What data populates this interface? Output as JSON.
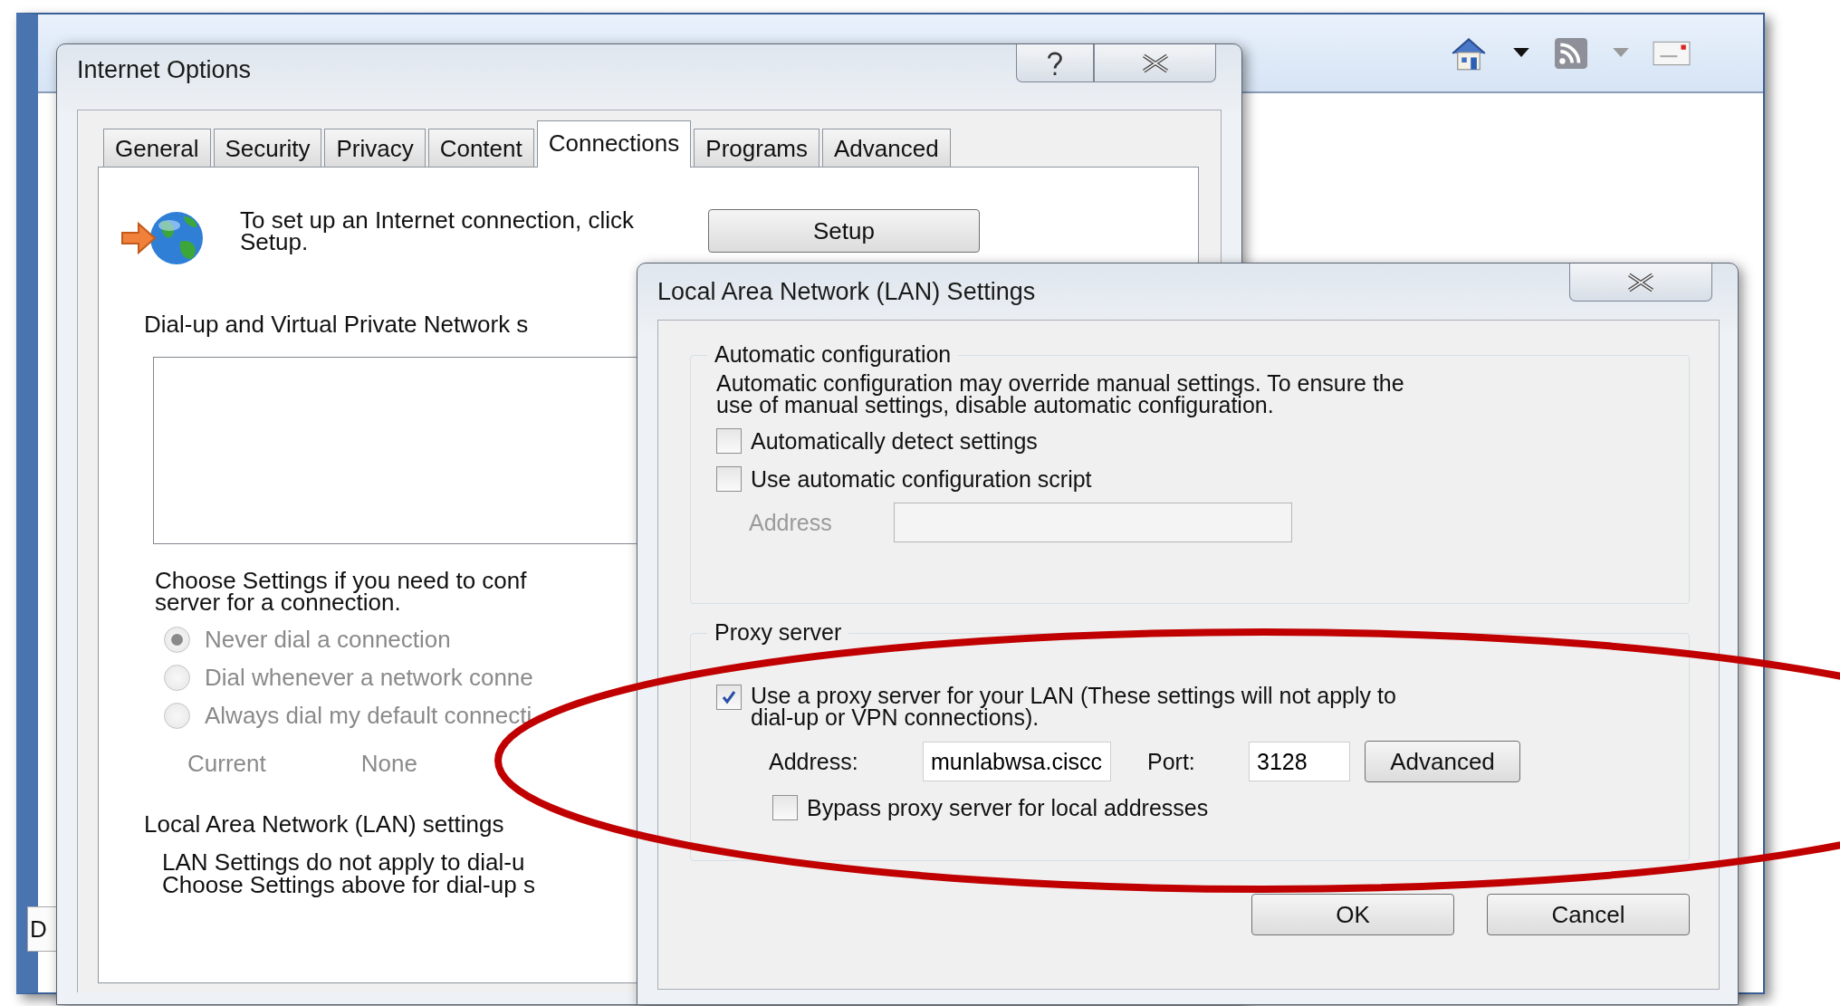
{
  "browser": {
    "tab_label": "D"
  },
  "internet_options": {
    "title": "Internet Options",
    "tabs": [
      {
        "label": "General",
        "selected": false
      },
      {
        "label": "Security",
        "selected": false
      },
      {
        "label": "Privacy",
        "selected": false
      },
      {
        "label": "Content",
        "selected": false
      },
      {
        "label": "Connections",
        "selected": true
      },
      {
        "label": "Programs",
        "selected": false
      },
      {
        "label": "Advanced",
        "selected": false
      }
    ],
    "setup_text": [
      "To set up an Internet connection, click",
      "Setup."
    ],
    "setup_button": "Setup",
    "dialup_heading": "Dial-up and Virtual Private Network s",
    "choose_text": [
      "Choose Settings if you need to conf",
      "server for a connection."
    ],
    "dial_options": [
      {
        "label": "Never dial a connection",
        "selected": true,
        "disabled": true
      },
      {
        "label": "Dial whenever a network conne",
        "selected": false,
        "disabled": true
      },
      {
        "label": "Always dial my default connecti",
        "selected": false,
        "disabled": true
      }
    ],
    "current_label": "Current",
    "current_value": "None",
    "lan_heading": "Local Area Network (LAN) settings",
    "lan_text": [
      "LAN Settings do not apply to dial-u",
      "Choose Settings above for dial-up s"
    ]
  },
  "lan_dialog": {
    "title": "Local Area Network (LAN) Settings",
    "auto_config": {
      "legend": "Automatic configuration",
      "description": [
        "Automatic configuration may override manual settings.  To ensure the",
        "use of manual settings, disable automatic configuration."
      ],
      "options": [
        {
          "label": "Automatically detect settings",
          "checked": false
        },
        {
          "label": "Use automatic configuration script",
          "checked": false
        }
      ],
      "address": {
        "label": "Address",
        "disabled": true
      }
    },
    "proxy": {
      "legend": "Proxy server",
      "use_proxy": {
        "label": [
          "Use a proxy server for your LAN (These settings will not apply to",
          "dial-up or VPN connections)."
        ],
        "checked": true
      },
      "address_label": "Address:",
      "address_value": "munlabwsa.ciscc",
      "port_label": "Port:",
      "port_value": "3128",
      "advanced_button": "Advanced",
      "bypass": {
        "label": "Bypass proxy server for local addresses",
        "checked": false
      }
    },
    "buttons": [
      "OK",
      "Cancel"
    ]
  }
}
